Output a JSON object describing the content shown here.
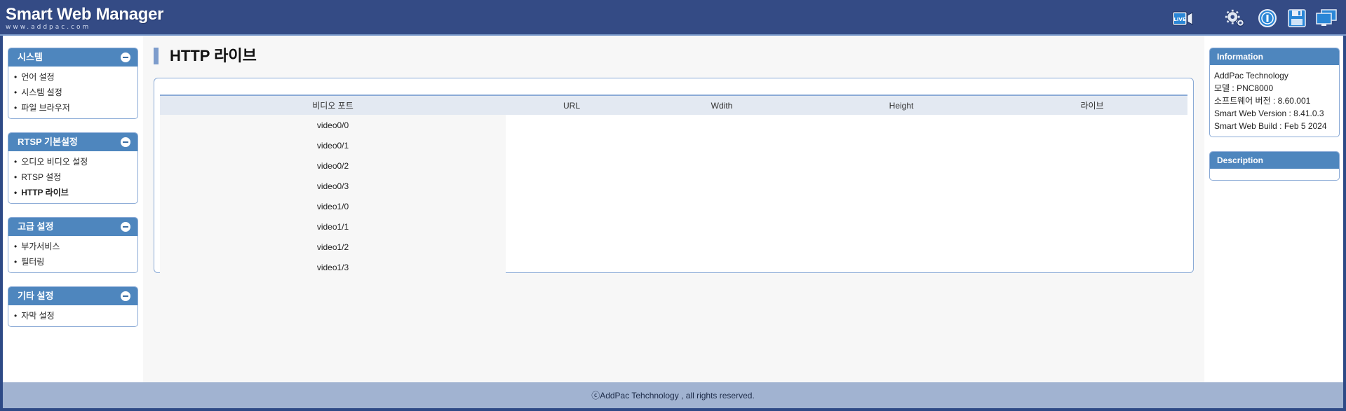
{
  "header": {
    "logo_title": "Smart Web Manager",
    "logo_subtitle": "www.addpac.com",
    "icons": [
      "live-camera-icon",
      "settings-gears-icon",
      "info-icon",
      "save-icon",
      "monitor-icon"
    ],
    "live_label": "LIVE"
  },
  "sidebar": {
    "groups": [
      {
        "title": "시스템",
        "items": [
          "언어 설정",
          "시스템 설정",
          "파일 브라우저"
        ]
      },
      {
        "title": "RTSP 기본설정",
        "items": [
          "오디오 비디오 설정",
          "RTSP 설정",
          "HTTP 라이브"
        ]
      },
      {
        "title": "고급 설정",
        "items": [
          "부가서비스",
          "필터링"
        ]
      },
      {
        "title": "기타 설정",
        "items": [
          "자막 설정"
        ]
      }
    ]
  },
  "main": {
    "title": "HTTP 라이브",
    "table": {
      "headers": [
        "비디오 포트",
        "URL",
        "Wdith",
        "Height",
        "라이브"
      ],
      "rows": [
        "video0/0",
        "video0/1",
        "video0/2",
        "video0/3",
        "video1/0",
        "video1/1",
        "video1/2",
        "video1/3"
      ]
    }
  },
  "info": {
    "title": "Information",
    "lines": [
      "AddPac Technology",
      "모델 : PNC8000",
      "소프트웨어 버전 : 8.60.001",
      "Smart Web Version : 8.41.0.3",
      "Smart Web Build : Feb 5 2024"
    ]
  },
  "description": {
    "title": "Description"
  },
  "footer": {
    "text": "ⓒAddPac Tehchnology , all rights reserved."
  },
  "colors": {
    "header_bg": "#344b85",
    "accent": "#4e86be",
    "footer_bg": "#a1b3d1"
  }
}
